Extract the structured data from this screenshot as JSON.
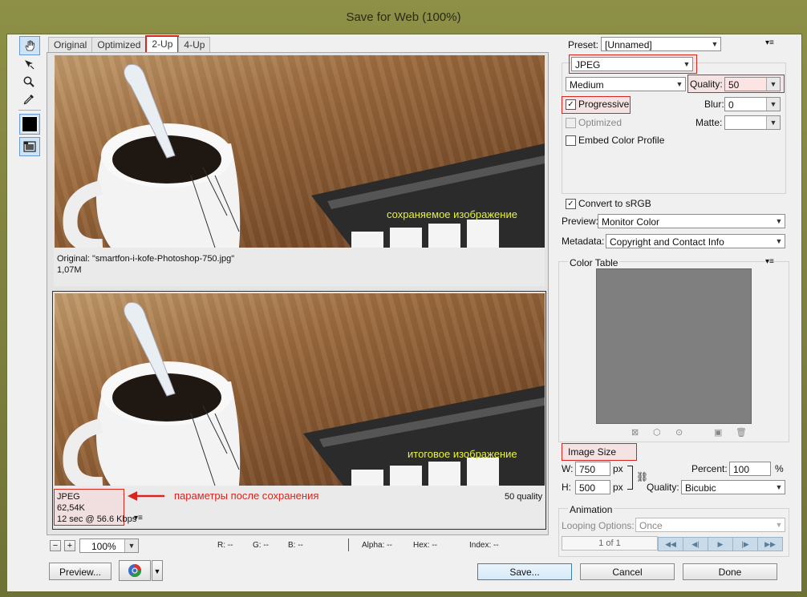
{
  "window": {
    "title": "Save for Web (100%)"
  },
  "tabs": [
    {
      "label": "Original"
    },
    {
      "label": "Optimized"
    },
    {
      "label": "2-Up"
    },
    {
      "label": "4-Up"
    }
  ],
  "top_pane": {
    "caption": "сохраняемое изображение",
    "info_name": "Original: \"smartfon-i-kofe-Photoshop-750.jpg\"",
    "info_size": "1,07M"
  },
  "bottom_pane": {
    "caption": "итоговое изображение",
    "info_format": "JPEG",
    "info_size": "62,54K",
    "info_time": "12 sec @ 56.6 Kbps",
    "info_quality": "50 quality",
    "annotation": "параметры после сохранения"
  },
  "zoom": {
    "value": "100%"
  },
  "status": {
    "r": "R: --",
    "g": "G: --",
    "b": "B: --",
    "alpha": "Alpha: --",
    "hex": "Hex: --",
    "index": "Index: --"
  },
  "settings": {
    "preset_label": "Preset:",
    "preset_value": "[Unnamed]",
    "format_value": "JPEG",
    "compression_value": "Medium",
    "quality_label": "Quality:",
    "quality_value": "50",
    "progressive_label": "Progressive",
    "progressive_checked": true,
    "blur_label": "Blur:",
    "blur_value": "0",
    "optimized_label": "Optimized",
    "matte_label": "Matte:",
    "embed_label": "Embed Color Profile",
    "srgb_label": "Convert to sRGB",
    "preview_label": "Preview:",
    "preview_value": "Monitor Color",
    "metadata_label": "Metadata:",
    "metadata_value": "Copyright and Contact Info"
  },
  "color_table": {
    "title": "Color Table",
    "swatch_color": "#7f7f7f"
  },
  "image_size": {
    "title": "Image Size",
    "w_label": "W:",
    "w_value": "750",
    "w_unit": "px",
    "h_label": "H:",
    "h_value": "500",
    "h_unit": "px",
    "percent_label": "Percent:",
    "percent_value": "100",
    "percent_unit": "%",
    "quality_label": "Quality:",
    "quality_value": "Bicubic"
  },
  "animation": {
    "title": "Animation",
    "looping_label": "Looping Options:",
    "looping_value": "Once",
    "frame_counter": "1 of 1"
  },
  "buttons": {
    "preview": "Preview...",
    "save": "Save...",
    "cancel": "Cancel",
    "done": "Done"
  },
  "colors": {
    "highlight": "#d9251f",
    "caption": "#e8f23a",
    "accent": "#3c7fb1"
  }
}
